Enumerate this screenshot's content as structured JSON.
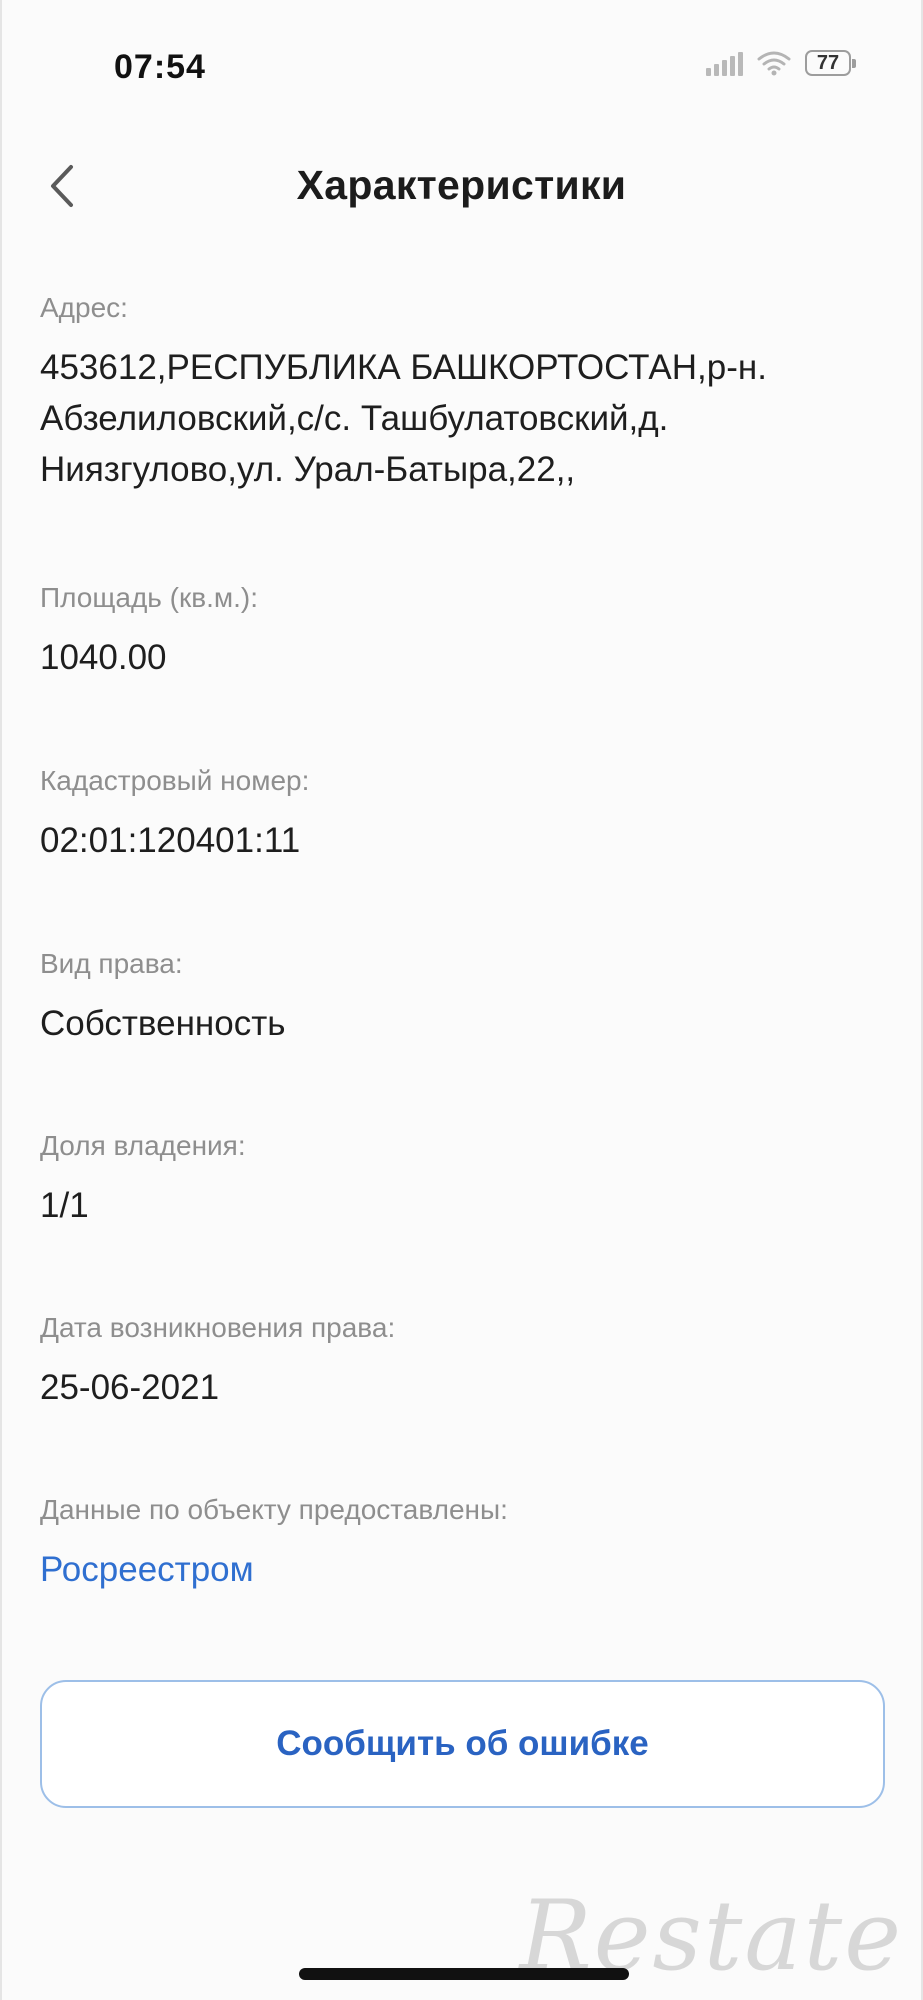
{
  "status_bar": {
    "time": "07:54",
    "battery": "77",
    "signal_icon": "signal-bars-icon",
    "wifi_icon": "wifi-icon"
  },
  "header": {
    "back_icon": "chevron-left-icon",
    "title": "Характеристики"
  },
  "fields": {
    "address": {
      "label": "Адрес:",
      "value": "453612,РЕСПУБЛИКА БАШКОРТОСТАН,р-н. Абзелиловский,с/с. Ташбулатовский,д. Ниязгулово,ул. Урал-Батыра,22,,"
    },
    "area": {
      "label": "Площадь (кв.м.):",
      "value": "1040.00"
    },
    "cadastral_number": {
      "label": "Кадастровый номер:",
      "value": "02:01:120401:11"
    },
    "right_type": {
      "label": "Вид права:",
      "value": "Собственность"
    },
    "ownership_share": {
      "label": "Доля владения:",
      "value": "1/1"
    },
    "right_date": {
      "label": "Дата возникновения права:",
      "value": "25-06-2021"
    },
    "data_source": {
      "label": "Данные по объекту предоставлены:",
      "value": "Росреестром"
    }
  },
  "report_button": {
    "label": "Сообщить об ошибке"
  },
  "watermark": {
    "text": "Restate"
  },
  "colors": {
    "accent": "#2a63c2",
    "link": "#2f6fd0",
    "label": "#8e8e8e",
    "button_border": "#9dbfe8"
  }
}
